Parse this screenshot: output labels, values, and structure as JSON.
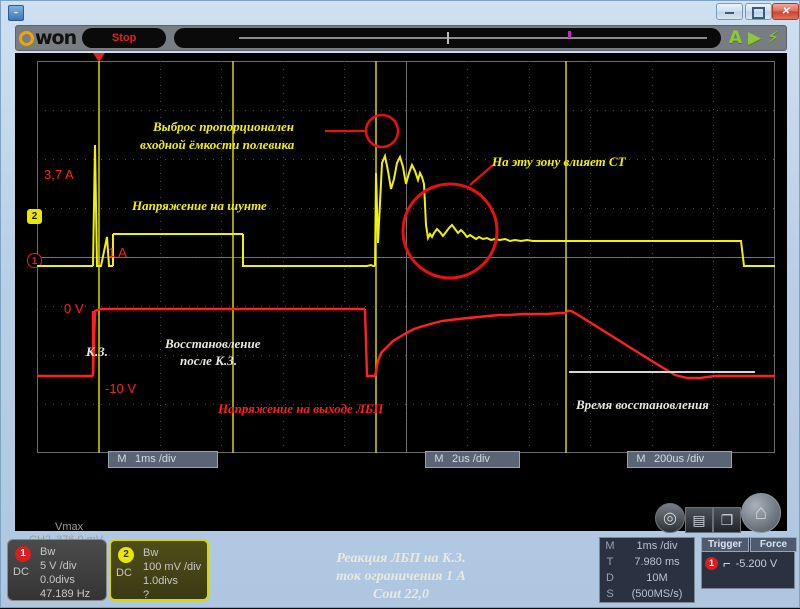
{
  "window": {
    "buttons": {
      "minimize": "—",
      "maximize": "❐",
      "close": "✕"
    }
  },
  "toolbar": {
    "brand": "won",
    "run_state": "Stop",
    "icons": [
      {
        "name": "auto-icon",
        "glyph": "A"
      },
      {
        "name": "play-icon",
        "glyph": "▶"
      },
      {
        "name": "bolt-icon",
        "glyph": "⚡"
      }
    ]
  },
  "screen": {
    "channel_markers": [
      {
        "name": "2",
        "label": "2"
      },
      {
        "name": "1",
        "label": "1"
      }
    ],
    "annotations": [
      {
        "id": "a1",
        "text": "Выброс пропорционален",
        "color": "#f2f200"
      },
      {
        "id": "a2",
        "text": "входной ёмкости полевика",
        "color": "#f2f200"
      },
      {
        "id": "a3",
        "text": "На эту зону влияет СТ",
        "color": "#f2f200"
      },
      {
        "id": "a4",
        "text": "Напряжение на шунте",
        "color": "#f2f200"
      },
      {
        "id": "a5",
        "text": "Восстановление",
        "color": "#e8e8e0"
      },
      {
        "id": "a6",
        "text": "после К.З.",
        "color": "#e8e8e0"
      },
      {
        "id": "a7",
        "text": "К.З.",
        "color": "#e8e8e0"
      },
      {
        "id": "a8",
        "text": "Напряжение на выходе ЛБП",
        "color": "#ff1d1d"
      },
      {
        "id": "a9",
        "text": "Время восстановления",
        "color": "#e8e8e0"
      }
    ],
    "value_labels": [
      {
        "id": "v1",
        "text": "3,7 A",
        "color": "#ff2020"
      },
      {
        "id": "v2",
        "text": "1 A",
        "color": "#ff2020"
      },
      {
        "id": "v3",
        "text": "0 V",
        "color": "#ff2020"
      },
      {
        "id": "v4",
        "text": "-10 V",
        "color": "#ff2020"
      }
    ],
    "timebase_badges": [
      {
        "m": "M",
        "value": "1ms /div"
      },
      {
        "m": "M",
        "value": "2us /div"
      },
      {
        "m": "M",
        "value": "200us /div"
      }
    ],
    "measurement": {
      "channel": "CH2",
      "name": "Vmax",
      "value": "376.0 mV"
    },
    "caption": [
      "Реакция ЛБП на К.З.",
      "ток ограничения 1 А",
      "Cout  22,0"
    ],
    "screen_icons": [
      {
        "name": "zoom-measure-icon",
        "glyph": "◎"
      },
      {
        "name": "save-icon",
        "glyph": "▤"
      },
      {
        "name": "copy-window-icon",
        "glyph": "❐"
      },
      {
        "name": "home-icon",
        "glyph": "⌂"
      }
    ]
  },
  "channels": [
    {
      "number": "1",
      "coupling": "DC",
      "bandwidth": "Bw",
      "scale": "5 V /div",
      "offset": "0.0divs",
      "frequency": "47.189 Hz"
    },
    {
      "number": "2",
      "coupling": "DC",
      "bandwidth": "Bw",
      "scale": "100 mV /div",
      "offset": "1.0divs",
      "frequency": "?"
    }
  ],
  "timebase_panel": [
    {
      "key": "M",
      "value": "1ms /div"
    },
    {
      "key": "T",
      "value": "7.980 ms"
    },
    {
      "key": "D",
      "value": "10M"
    },
    {
      "key": "S",
      "value": "(500MS/s)"
    }
  ],
  "trigger_panel": {
    "tab_trigger": "Trigger",
    "tab_force": "Force",
    "source": "1",
    "slope_icon": "rising-edge-icon",
    "level": "-5.200 V"
  },
  "chart_data": {
    "type": "line",
    "title": "Реакция ЛБП на К.З.",
    "xlabel": "",
    "ylabel": "",
    "grid": true,
    "series": [
      {
        "name": "CH2 — Напряжение на шунте",
        "color": "#f2f200",
        "unit_per_div": "100 mV /div",
        "annotated_levels": [
          {
            "label": "3,7 A",
            "value": 3.7
          },
          {
            "label": "1 A",
            "value": 1.0
          }
        ]
      },
      {
        "name": "CH1 — Напряжение на выходе ЛБП",
        "color": "#ff2020",
        "unit_per_div": "5 V /div",
        "annotated_levels": [
          {
            "label": "0 V",
            "value": 0
          },
          {
            "label": "-10 V",
            "value": -10
          }
        ]
      }
    ],
    "timebases": [
      "1ms /div",
      "2us /div",
      "200us /div"
    ]
  }
}
